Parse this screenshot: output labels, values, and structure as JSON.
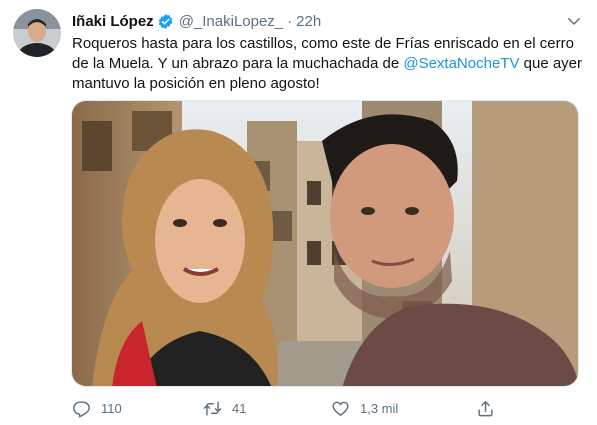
{
  "tweet": {
    "author_name": "Iñaki López",
    "handle": "@_InakiLopez_",
    "separator": "·",
    "time": "22h",
    "verified": true,
    "text_before_mention": "Roqueros hasta para los castillos, como este de Frías enriscado en el cerro de la Muela. Y un abrazo para la muchachada de ",
    "mention": "@SextaNocheTV",
    "text_after_mention": " que ayer mantuvo la posición en pleno agosto!",
    "photo": "selfie-photo"
  },
  "actions": {
    "reply_count": "110",
    "retweet_count": "41",
    "like_count": "1,3 mil",
    "icons": [
      "reply-icon",
      "retweet-icon",
      "like-icon",
      "share-icon"
    ]
  },
  "colors": {
    "accent": "#1b95e0",
    "verified": "#1da1f2",
    "secondary_text": "#5b7083"
  }
}
